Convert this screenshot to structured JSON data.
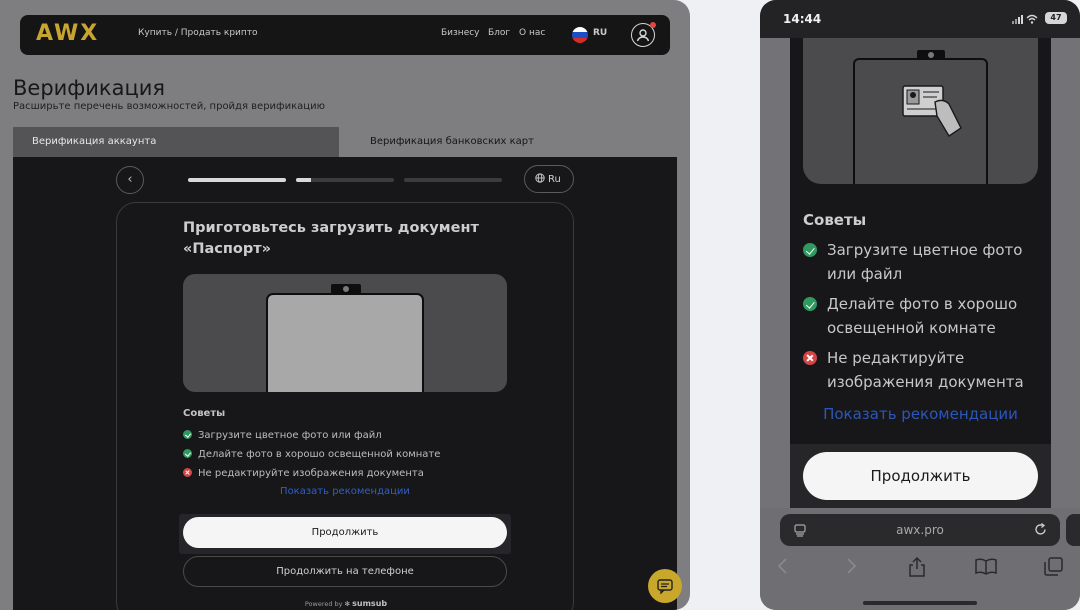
{
  "desktop": {
    "header": {
      "logo": "AWX",
      "buy_sell": "Купить / Продать крипто",
      "links": [
        "Бизнесу",
        "Блог",
        "О нас"
      ],
      "lang": "RU"
    },
    "page": {
      "title": "Верификация",
      "subtitle": "Расширьте перечень возможностей, пройдя верификацию"
    },
    "tabs": [
      "Верификация аккаунта",
      "Верификация банковских карт"
    ],
    "sdk": {
      "back_symbol": "‹",
      "lang_button": "Ru",
      "progress": [
        1.0,
        0.15,
        0.0
      ],
      "title": "Приготовьтесь загрузить документ «Паспорт»",
      "tips_heading": "Советы",
      "tips": [
        {
          "text": "Загрузите цветное фото или файл",
          "status": "ok"
        },
        {
          "text": "Делайте фото в хорошо освещенной комнате",
          "status": "ok"
        },
        {
          "text": "Не редактируйте изображения документа",
          "status": "bad"
        }
      ],
      "show_recommendations": "Показать рекомендации",
      "continue_label": "Продолжить",
      "continue_phone_label": "Продолжить на телефоне",
      "powered_by": "Powered by",
      "powered_brand": "sumsub"
    }
  },
  "mobile": {
    "status": {
      "time": "14:44",
      "battery": "47"
    },
    "sdk": {
      "tips_heading": "Советы",
      "tips": [
        {
          "text": "Загрузите цветное фото или файл",
          "status": "ok"
        },
        {
          "text": "Делайте фото в хорошо освещенной комнате",
          "status": "ok"
        },
        {
          "text": "Не редактируйте изображения документа",
          "status": "bad"
        }
      ],
      "show_recommendations": "Показать рекомендации",
      "continue_label": "Продолжить"
    },
    "browser": {
      "url": "awx.pro"
    }
  },
  "colors": {
    "accent_gold": "#c8a430",
    "link_blue": "#2f5fc4",
    "ok_green": "#2f9a5f",
    "error_red": "#d34545"
  },
  "icons": [
    "back-arrow-icon",
    "globe-icon",
    "profile-icon",
    "check-icon",
    "cross-icon",
    "chat-icon",
    "tabs-icon",
    "reload-icon",
    "share-icon",
    "bookmarks-icon"
  ]
}
